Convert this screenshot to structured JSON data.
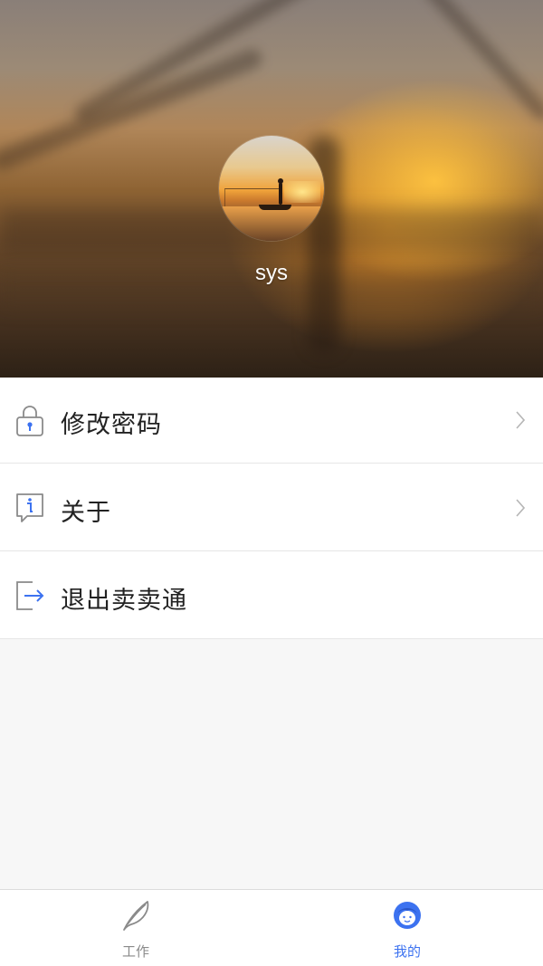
{
  "profile": {
    "username": "sys"
  },
  "menu": {
    "items": [
      {
        "label": "修改密码",
        "icon": "lock-icon",
        "has_chevron": true
      },
      {
        "label": "关于",
        "icon": "info-icon",
        "has_chevron": true
      },
      {
        "label": "退出卖卖通",
        "icon": "logout-icon",
        "has_chevron": false
      }
    ]
  },
  "tabbar": {
    "tabs": [
      {
        "label": "工作",
        "icon": "feather-icon",
        "active": false
      },
      {
        "label": "我的",
        "icon": "user-face-icon",
        "active": true
      }
    ]
  },
  "colors": {
    "accent": "#3c72f0",
    "icon_gray": "#8a8a8a",
    "list_text": "#222222",
    "background": "#f7f7f7"
  }
}
